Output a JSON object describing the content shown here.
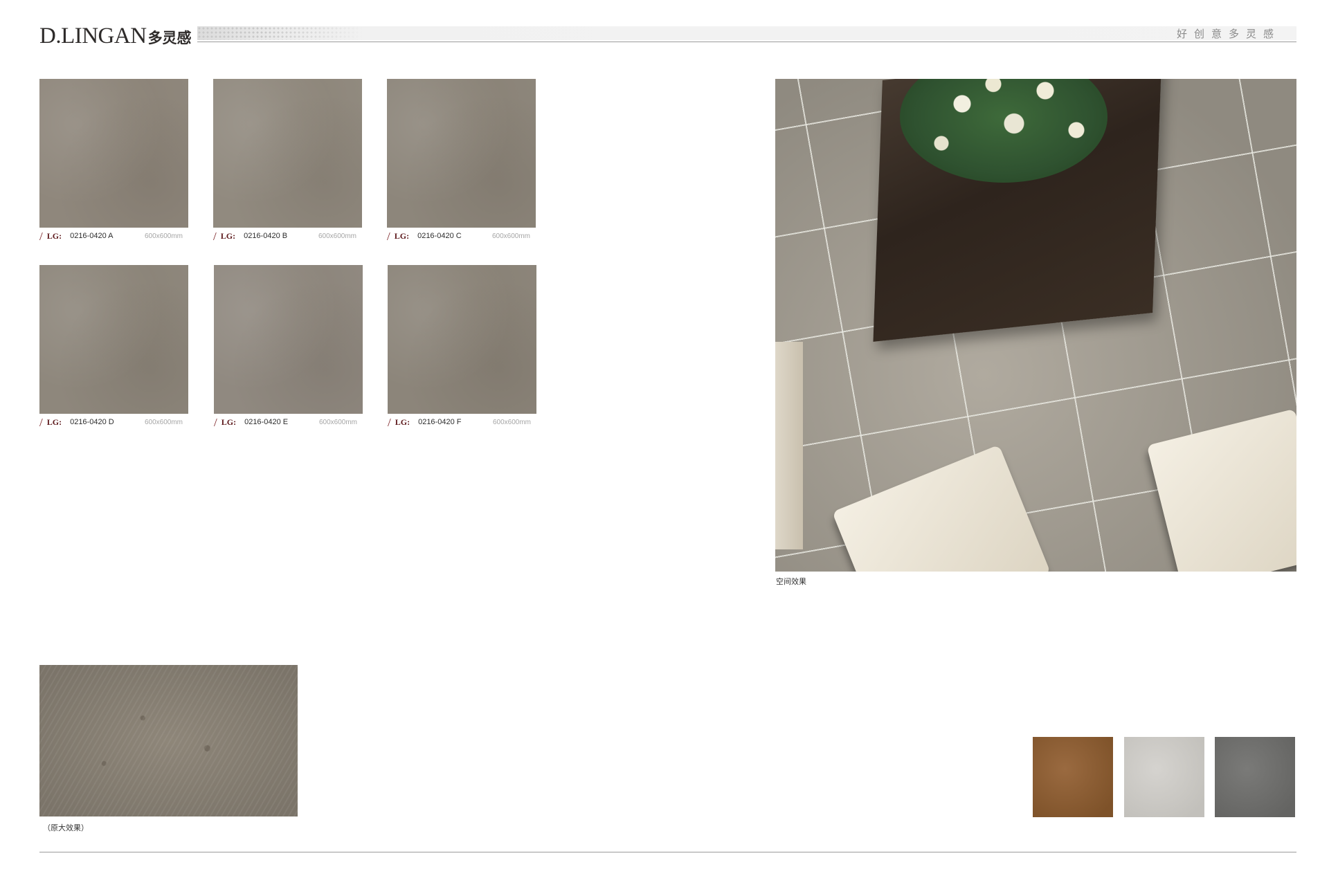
{
  "header": {
    "logo_latin": "D.LINGAN",
    "logo_cn": "多灵感",
    "slogan": "好创意多灵感"
  },
  "tiles": [
    {
      "slash": "/",
      "prefix": "LG:",
      "code": "0216-0420 A",
      "size": "600x600mm"
    },
    {
      "slash": "/",
      "prefix": "LG:",
      "code": "0216-0420 B",
      "size": "600x600mm"
    },
    {
      "slash": "/",
      "prefix": "LG:",
      "code": "0216-0420 C",
      "size": "600x600mm"
    },
    {
      "slash": "/",
      "prefix": "LG:",
      "code": "0216-0420 D",
      "size": "600x600mm"
    },
    {
      "slash": "/",
      "prefix": "LG:",
      "code": "0216-0420 E",
      "size": "600x600mm"
    },
    {
      "slash": "/",
      "prefix": "LG:",
      "code": "0216-0420 F",
      "size": "600x600mm"
    }
  ],
  "scene": {
    "caption": "空间效果"
  },
  "detail": {
    "caption": "（原大效果）"
  },
  "colors": {
    "tile_base": "#8f877c",
    "accent": "#7a1f23",
    "swatches": [
      "#8a5e35",
      "#cbc9c5",
      "#6f6f6d"
    ]
  }
}
